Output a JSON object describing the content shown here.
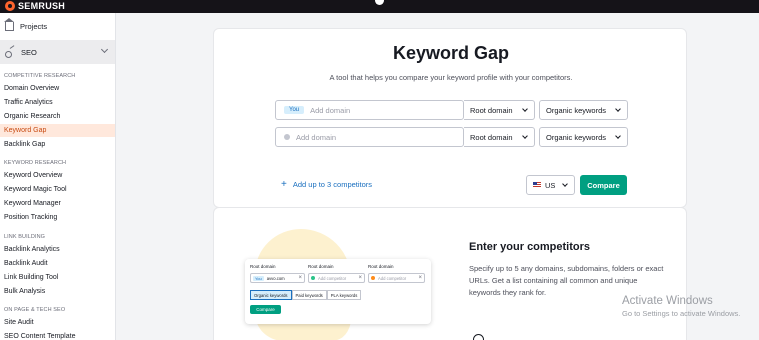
{
  "topbar": {
    "brand": "SEMRUSH"
  },
  "sidebar": {
    "projects_label": "Projects",
    "seo_label": "SEO",
    "sections": [
      {
        "title": "COMPETITIVE RESEARCH",
        "items": [
          "Domain Overview",
          "Traffic Analytics",
          "Organic Research",
          "Keyword Gap",
          "Backlink Gap"
        ]
      },
      {
        "title": "KEYWORD RESEARCH",
        "items": [
          "Keyword Overview",
          "Keyword Magic Tool",
          "Keyword Manager",
          "Position Tracking"
        ]
      },
      {
        "title": "LINK BUILDING",
        "items": [
          "Backlink Analytics",
          "Backlink Audit",
          "Link Building Tool",
          "Bulk Analysis"
        ]
      },
      {
        "title": "ON PAGE & TECH SEO",
        "items": [
          "Site Audit",
          "SEO Content Template"
        ]
      }
    ],
    "active_item": "Keyword Gap"
  },
  "main": {
    "title": "Keyword Gap",
    "subtitle": "A tool that helps you compare your keyword profile with your competitors.",
    "rows": [
      {
        "badge": "You",
        "placeholder": "Add domain",
        "root": "Root domain",
        "keywords": "Organic keywords"
      },
      {
        "badge": "",
        "placeholder": "Add domain",
        "root": "Root domain",
        "keywords": "Organic keywords"
      }
    ],
    "add_competitors": "Add up to 3 competitors",
    "country": "US",
    "compare": "Compare"
  },
  "promo": {
    "title": "Enter your competitors",
    "description": "Specify up to 5 any domains, subdomains, folders or exact URLs. Get a list containing all common and unique keywords they rank for.",
    "mock": {
      "root_labels": [
        "Root domain",
        "Root domain",
        "Root domain"
      ],
      "you_badge": "You",
      "domain": "avvo.com",
      "placeholders": [
        "Add competitor",
        "Add competitor"
      ],
      "tabs": [
        "Organic keywords",
        "Paid keywords",
        "PLA keywords"
      ],
      "button": "Compare"
    }
  },
  "watermark": {
    "line1": "Activate Windows",
    "line2": "Go to Settings to activate Windows."
  },
  "colors": {
    "accent": "#ff642d",
    "compare": "#009f81",
    "link": "#1a6fbf",
    "active_bg": "#ffe8dc"
  }
}
